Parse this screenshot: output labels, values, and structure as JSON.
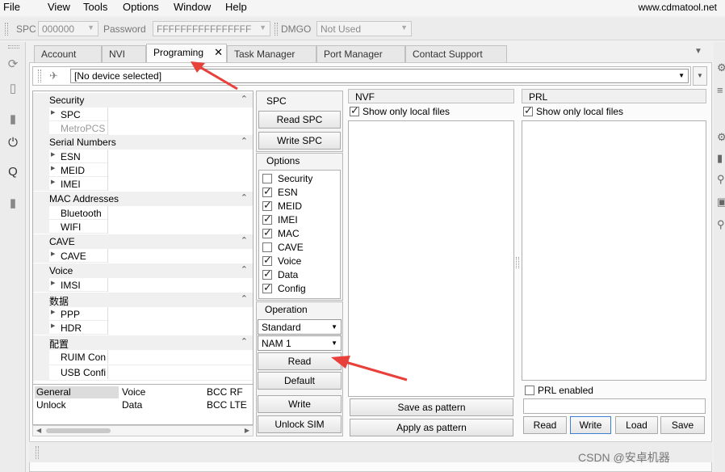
{
  "menu": {
    "items": [
      "File",
      "View",
      "Tools",
      "Options",
      "Window",
      "Help"
    ],
    "site": "www.cdmatool.net"
  },
  "fieldbar": {
    "spc_label": "SPC",
    "spc_value": "000000",
    "password_label": "Password",
    "password_value": "FFFFFFFFFFFFFFFF",
    "dmgo_label": "DMGO",
    "dmgo_value": "Not Used"
  },
  "tabs": [
    {
      "label": "Account"
    },
    {
      "label": "NVI"
    },
    {
      "label": "Programing",
      "active": true
    },
    {
      "label": "Task Manager"
    },
    {
      "label": "Port Manager"
    },
    {
      "label": "Contact Support"
    }
  ],
  "device": {
    "value": "[No device selected]"
  },
  "property_grid": {
    "security": {
      "title": "Security",
      "spc": "SPC",
      "metropcs": "MetroPCS"
    },
    "serial": {
      "title": "Serial Numbers",
      "esn": "ESN",
      "meid": "MEID",
      "imei": "IMEI"
    },
    "mac": {
      "title": "MAC Addresses",
      "bluetooth": "Bluetooth",
      "wifi": "WIFI"
    },
    "cave": {
      "title": "CAVE",
      "cave": "CAVE"
    },
    "voice": {
      "title": "Voice",
      "imsi": "IMSI"
    },
    "data": {
      "title": "数据",
      "ppp": "PPP",
      "hdr": "HDR"
    },
    "config": {
      "title": "配置",
      "ruim": "RUIM Conf",
      "usb": "USB Config"
    }
  },
  "bottom_grid": {
    "general": "General",
    "voice": "Voice",
    "bcc_rf": "BCC RF",
    "unlock": "Unlock",
    "data": "Data",
    "bcc_lte": "BCC LTE"
  },
  "spc_group": {
    "title": "SPC",
    "read": "Read SPC",
    "write": "Write SPC"
  },
  "options": {
    "title": "Options",
    "items": [
      {
        "label": "Security",
        "checked": false
      },
      {
        "label": "ESN",
        "checked": true
      },
      {
        "label": "MEID",
        "checked": true
      },
      {
        "label": "IMEI",
        "checked": true
      },
      {
        "label": "MAC",
        "checked": true
      },
      {
        "label": "CAVE",
        "checked": false
      },
      {
        "label": "Voice",
        "checked": true
      },
      {
        "label": "Data",
        "checked": true
      },
      {
        "label": "Config",
        "checked": true
      }
    ]
  },
  "operation": {
    "title": "Operation",
    "mode": "Standard",
    "nam": "NAM 1",
    "read": "Read",
    "default": "Default",
    "write": "Write",
    "unlock_sim": "Unlock SIM"
  },
  "nvf": {
    "title": "NVF",
    "show_local": "Show only local files",
    "save_pattern": "Save as pattern",
    "apply_pattern": "Apply as pattern"
  },
  "prl": {
    "title": "PRL",
    "show_local": "Show only local files",
    "prl_enabled": "PRL enabled",
    "read": "Read",
    "write": "Write",
    "load": "Load",
    "save": "Save"
  },
  "watermark": "CSDN @安卓机器",
  "colors": {
    "arrow": "#e8403a",
    "accent_border": "#3c7fd0"
  }
}
